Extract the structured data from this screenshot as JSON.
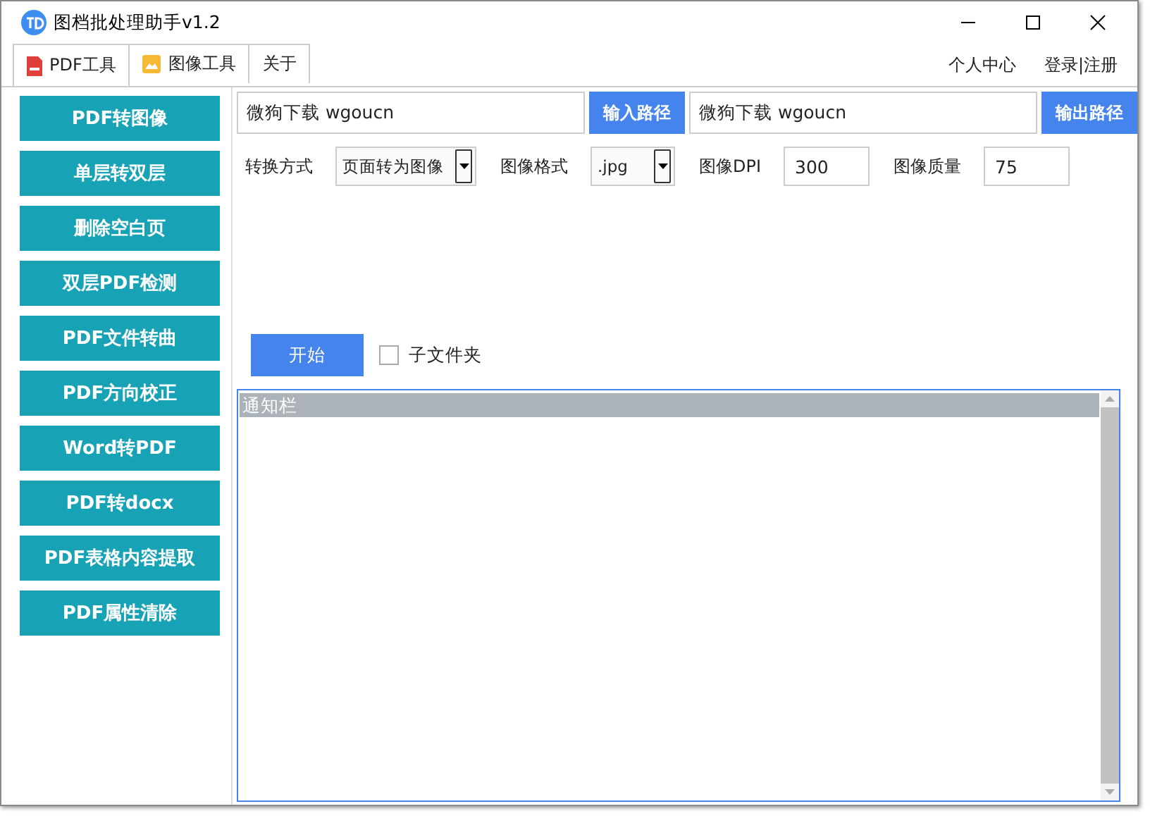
{
  "window": {
    "title": "图档批处理助手v1.2"
  },
  "tabs": [
    {
      "label": "PDF工具",
      "selected": true
    },
    {
      "label": "图像工具",
      "selected": false
    },
    {
      "label": "关于",
      "selected": false
    }
  ],
  "header_links": [
    "个人中心",
    "登录|注册"
  ],
  "sidebar": {
    "items": [
      "PDF转图像",
      "单层转双层",
      "删除空白页",
      "双层PDF检测",
      "PDF文件转曲",
      "PDF方向校正",
      "Word转PDF",
      "PDF转docx",
      "PDF表格内容提取",
      "PDF属性清除"
    ]
  },
  "paths": {
    "input_value": "微狗下载 wgoucn",
    "input_button": "输入路径",
    "output_value": "微狗下载 wgoucn",
    "output_button": "输出路径"
  },
  "options": [
    {
      "kind": "select",
      "label": "转换方式",
      "value": "页面转为图像"
    },
    {
      "kind": "select",
      "label": "图像格式",
      "value": ".jpg"
    },
    {
      "kind": "input",
      "label": "图像DPI",
      "value": "300"
    },
    {
      "kind": "input",
      "label": "图像质量",
      "value": "75"
    }
  ],
  "start_button": "开始",
  "subfolder": {
    "label": "子文件夹",
    "checked": false
  },
  "notification_list": {
    "items": [
      {
        "text": "通知栏",
        "selected": true
      }
    ]
  }
}
